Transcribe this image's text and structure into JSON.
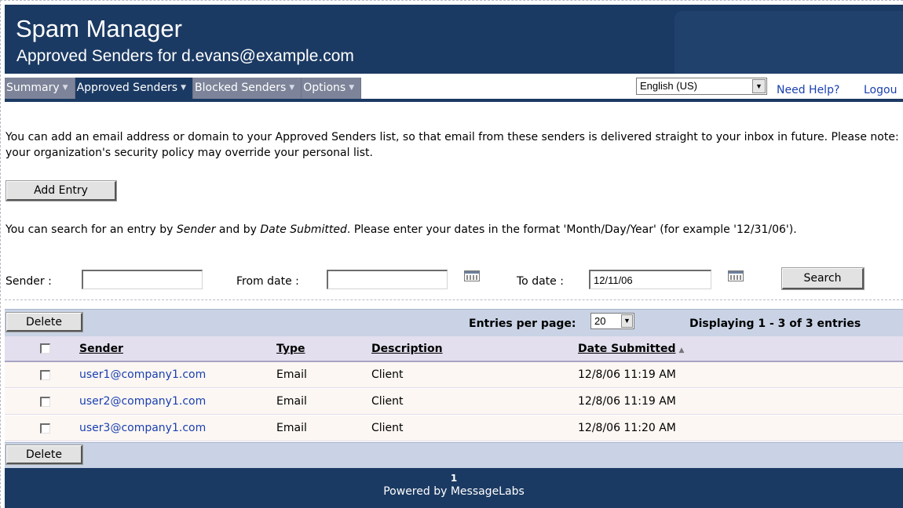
{
  "header": {
    "title": "Spam Manager",
    "subtitle": "Approved Senders for d.evans@example.com"
  },
  "nav": {
    "tabs": [
      {
        "label": "Summary",
        "active": false
      },
      {
        "label": "Approved Senders",
        "active": true
      },
      {
        "label": "Blocked Senders",
        "active": false
      },
      {
        "label": "Options",
        "active": false
      }
    ],
    "language": "English (US)",
    "help_label": "Need Help?",
    "logout_label": "Logou"
  },
  "intro_text": "You can add an email address or domain to your Approved Senders list, so that email from these senders is delivered straight to your inbox in future. Please note: your organization's security policy may override your personal list.",
  "add_entry_label": "Add Entry",
  "search_note": {
    "part1": "You can search for an entry by ",
    "sender_word": "Sender",
    "part2": " and by ",
    "date_word": "Date Submitted",
    "part3": ". Please enter your dates in the format 'Month/Day/Year' (for example '12/31/06')."
  },
  "search": {
    "sender_label": "Sender :",
    "sender_value": "",
    "from_label": "From date :",
    "from_value": "",
    "to_label": "To date :",
    "to_value": "12/11/06",
    "search_label": "Search"
  },
  "toolbar": {
    "delete_label": "Delete",
    "entries_per_page_label": "Entries per page:",
    "entries_per_page": "20",
    "display_info": "Displaying 1 - 3 of 3 entries"
  },
  "table": {
    "columns": [
      "Sender",
      "Type",
      "Description",
      "Date Submitted"
    ],
    "rows": [
      {
        "sender": "user1@company1.com",
        "type": "Email",
        "description": "Client",
        "date": "12/8/06 11:19 AM"
      },
      {
        "sender": "user2@company1.com",
        "type": "Email",
        "description": "Client",
        "date": "12/8/06 11:19 AM"
      },
      {
        "sender": "user3@company1.com",
        "type": "Email",
        "description": "Client",
        "date": "12/8/06 11:20 AM"
      }
    ]
  },
  "footer": {
    "page": "1",
    "powered_by": "Powered by MessageLabs"
  },
  "colors": {
    "header_bg": "#1b3a63",
    "nav_tab_bg": "#7d8499",
    "toolbar_bg": "#c9d3e5",
    "table_header_bg": "#e3dfee",
    "link": "#1a3fb0"
  }
}
